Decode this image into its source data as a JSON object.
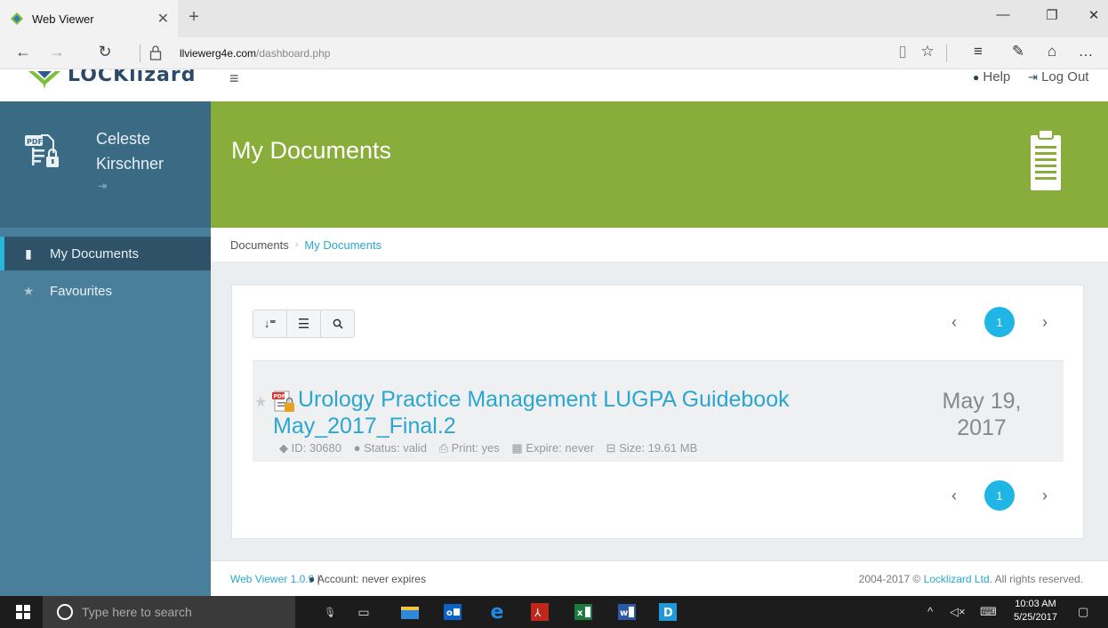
{
  "browser": {
    "tab_title": "Web Viewer",
    "url_domain": "llviewerg4e.com",
    "url_path": "/dashboard.php"
  },
  "header": {
    "logo_text": "LOCKlizard",
    "help_label": "Help",
    "logout_label": "Log Out"
  },
  "sidebar": {
    "user_name": "Celeste Kirschner",
    "items": [
      {
        "label": "My Documents",
        "icon": "clipboard-icon",
        "active": true
      },
      {
        "label": "Favourites",
        "icon": "star-icon",
        "active": false
      }
    ]
  },
  "main": {
    "page_title": "My Documents",
    "breadcrumb": {
      "root": "Documents",
      "separator": "›",
      "current": "My Documents"
    },
    "pagination": {
      "current_page": "1"
    },
    "documents": [
      {
        "title": "Urology Practice Management LUGPA Guidebook May_2017_Final.2",
        "id": "ID: 30680",
        "status": "Status: valid",
        "print": "Print: yes",
        "expire": "Expire: never",
        "size": "Size: 19.61 MB",
        "date": "May 19, 2017"
      }
    ]
  },
  "footer": {
    "version": "Web Viewer 1.0.9",
    "separator": "|",
    "account": "Account: never expires",
    "copyright_prefix": "2004-2017 ©",
    "copyright_link": "Locklizard Ltd.",
    "copyright_suffix": "All rights reserved."
  },
  "taskbar": {
    "search_placeholder": "Type here to search",
    "time": "10:03 AM",
    "date": "5/25/2017"
  },
  "colors": {
    "banner": "#88ad3a",
    "sidebar": "#4a7f9c",
    "accent": "#29a8cf",
    "page_badge": "#1fb5e5"
  }
}
